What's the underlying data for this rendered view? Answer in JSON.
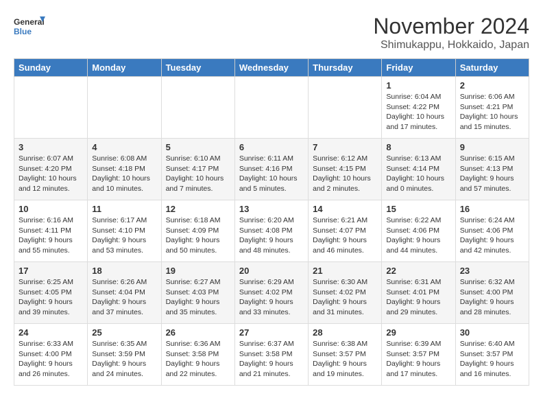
{
  "header": {
    "logo_line1": "General",
    "logo_line2": "Blue",
    "month": "November 2024",
    "location": "Shimukappu, Hokkaido, Japan"
  },
  "days_of_week": [
    "Sunday",
    "Monday",
    "Tuesday",
    "Wednesday",
    "Thursday",
    "Friday",
    "Saturday"
  ],
  "weeks": [
    [
      {
        "day": "",
        "info": ""
      },
      {
        "day": "",
        "info": ""
      },
      {
        "day": "",
        "info": ""
      },
      {
        "day": "",
        "info": ""
      },
      {
        "day": "",
        "info": ""
      },
      {
        "day": "1",
        "info": "Sunrise: 6:04 AM\nSunset: 4:22 PM\nDaylight: 10 hours\nand 17 minutes."
      },
      {
        "day": "2",
        "info": "Sunrise: 6:06 AM\nSunset: 4:21 PM\nDaylight: 10 hours\nand 15 minutes."
      }
    ],
    [
      {
        "day": "3",
        "info": "Sunrise: 6:07 AM\nSunset: 4:20 PM\nDaylight: 10 hours\nand 12 minutes."
      },
      {
        "day": "4",
        "info": "Sunrise: 6:08 AM\nSunset: 4:18 PM\nDaylight: 10 hours\nand 10 minutes."
      },
      {
        "day": "5",
        "info": "Sunrise: 6:10 AM\nSunset: 4:17 PM\nDaylight: 10 hours\nand 7 minutes."
      },
      {
        "day": "6",
        "info": "Sunrise: 6:11 AM\nSunset: 4:16 PM\nDaylight: 10 hours\nand 5 minutes."
      },
      {
        "day": "7",
        "info": "Sunrise: 6:12 AM\nSunset: 4:15 PM\nDaylight: 10 hours\nand 2 minutes."
      },
      {
        "day": "8",
        "info": "Sunrise: 6:13 AM\nSunset: 4:14 PM\nDaylight: 10 hours\nand 0 minutes."
      },
      {
        "day": "9",
        "info": "Sunrise: 6:15 AM\nSunset: 4:13 PM\nDaylight: 9 hours\nand 57 minutes."
      }
    ],
    [
      {
        "day": "10",
        "info": "Sunrise: 6:16 AM\nSunset: 4:11 PM\nDaylight: 9 hours\nand 55 minutes."
      },
      {
        "day": "11",
        "info": "Sunrise: 6:17 AM\nSunset: 4:10 PM\nDaylight: 9 hours\nand 53 minutes."
      },
      {
        "day": "12",
        "info": "Sunrise: 6:18 AM\nSunset: 4:09 PM\nDaylight: 9 hours\nand 50 minutes."
      },
      {
        "day": "13",
        "info": "Sunrise: 6:20 AM\nSunset: 4:08 PM\nDaylight: 9 hours\nand 48 minutes."
      },
      {
        "day": "14",
        "info": "Sunrise: 6:21 AM\nSunset: 4:07 PM\nDaylight: 9 hours\nand 46 minutes."
      },
      {
        "day": "15",
        "info": "Sunrise: 6:22 AM\nSunset: 4:06 PM\nDaylight: 9 hours\nand 44 minutes."
      },
      {
        "day": "16",
        "info": "Sunrise: 6:24 AM\nSunset: 4:06 PM\nDaylight: 9 hours\nand 42 minutes."
      }
    ],
    [
      {
        "day": "17",
        "info": "Sunrise: 6:25 AM\nSunset: 4:05 PM\nDaylight: 9 hours\nand 39 minutes."
      },
      {
        "day": "18",
        "info": "Sunrise: 6:26 AM\nSunset: 4:04 PM\nDaylight: 9 hours\nand 37 minutes."
      },
      {
        "day": "19",
        "info": "Sunrise: 6:27 AM\nSunset: 4:03 PM\nDaylight: 9 hours\nand 35 minutes."
      },
      {
        "day": "20",
        "info": "Sunrise: 6:29 AM\nSunset: 4:02 PM\nDaylight: 9 hours\nand 33 minutes."
      },
      {
        "day": "21",
        "info": "Sunrise: 6:30 AM\nSunset: 4:02 PM\nDaylight: 9 hours\nand 31 minutes."
      },
      {
        "day": "22",
        "info": "Sunrise: 6:31 AM\nSunset: 4:01 PM\nDaylight: 9 hours\nand 29 minutes."
      },
      {
        "day": "23",
        "info": "Sunrise: 6:32 AM\nSunset: 4:00 PM\nDaylight: 9 hours\nand 28 minutes."
      }
    ],
    [
      {
        "day": "24",
        "info": "Sunrise: 6:33 AM\nSunset: 4:00 PM\nDaylight: 9 hours\nand 26 minutes."
      },
      {
        "day": "25",
        "info": "Sunrise: 6:35 AM\nSunset: 3:59 PM\nDaylight: 9 hours\nand 24 minutes."
      },
      {
        "day": "26",
        "info": "Sunrise: 6:36 AM\nSunset: 3:58 PM\nDaylight: 9 hours\nand 22 minutes."
      },
      {
        "day": "27",
        "info": "Sunrise: 6:37 AM\nSunset: 3:58 PM\nDaylight: 9 hours\nand 21 minutes."
      },
      {
        "day": "28",
        "info": "Sunrise: 6:38 AM\nSunset: 3:57 PM\nDaylight: 9 hours\nand 19 minutes."
      },
      {
        "day": "29",
        "info": "Sunrise: 6:39 AM\nSunset: 3:57 PM\nDaylight: 9 hours\nand 17 minutes."
      },
      {
        "day": "30",
        "info": "Sunrise: 6:40 AM\nSunset: 3:57 PM\nDaylight: 9 hours\nand 16 minutes."
      }
    ]
  ]
}
